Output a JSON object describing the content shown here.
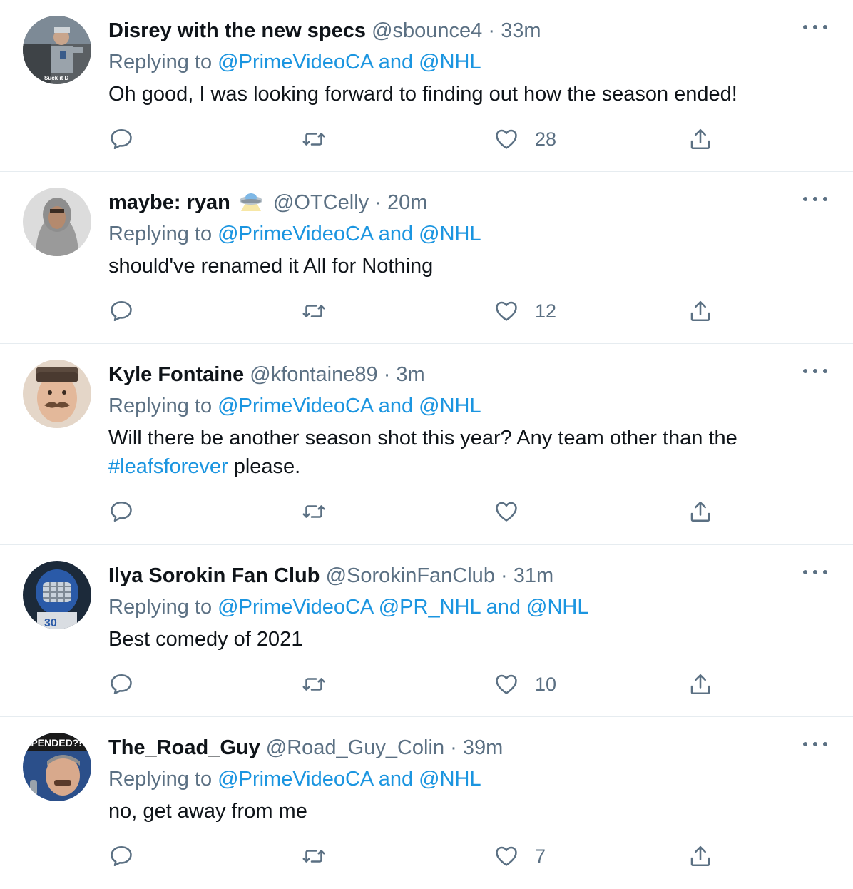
{
  "tweets": [
    {
      "name": "Disrey with the new specs",
      "handle": "@sbounce4",
      "separator": "·",
      "time": "33m",
      "replying_prefix": "Replying to",
      "reply_parts": [
        "@PrimeVideoCA",
        "and",
        "@NHL"
      ],
      "text": "Oh good, I was looking forward to finding out how the season ended!",
      "likes": "28",
      "avatar_caption": "Suck it D"
    },
    {
      "name": "maybe: ryan",
      "handle": "@OTCelly",
      "separator": "·",
      "time": "20m",
      "replying_prefix": "Replying to",
      "reply_parts": [
        "@PrimeVideoCA",
        "and",
        "@NHL"
      ],
      "text": "should've renamed it All for Nothing",
      "likes": "12",
      "emoji": "ufo"
    },
    {
      "name": "Kyle Fontaine",
      "handle": "@kfontaine89",
      "separator": "·",
      "time": "3m",
      "replying_prefix": "Replying to",
      "reply_parts": [
        "@PrimeVideoCA",
        "and",
        "@NHL"
      ],
      "text_before": "Will there be another season shot this year? Any team other than the",
      "hashtag": "#leafsforever",
      "text_after": " please.",
      "likes": ""
    },
    {
      "name": "Ilya Sorokin Fan Club",
      "handle": "@SorokinFanClub",
      "separator": "·",
      "time": "31m",
      "replying_prefix": "Replying to",
      "reply_parts": [
        "@PrimeVideoCA",
        "@PR_NHL",
        "and",
        "@NHL"
      ],
      "text": "Best comedy of 2021",
      "likes": "10",
      "avatar_caption": "30"
    },
    {
      "name": "The_Road_Guy",
      "handle": "@Road_Guy_Colin",
      "separator": "·",
      "time": "39m",
      "replying_prefix": "Replying to",
      "reply_parts": [
        "@PrimeVideoCA",
        "and",
        "@NHL"
      ],
      "text": "no, get away from me",
      "likes": "7",
      "avatar_caption": "SPENDED?!"
    }
  ],
  "icons": {
    "reply": "reply-icon",
    "retweet": "retweet-icon",
    "like": "heart-icon",
    "share": "share-icon",
    "more": "more-icon"
  },
  "colors": {
    "link": "#1b95e0",
    "muted": "#5b7083",
    "text": "#0f1419",
    "divider": "#e6ecf0"
  }
}
